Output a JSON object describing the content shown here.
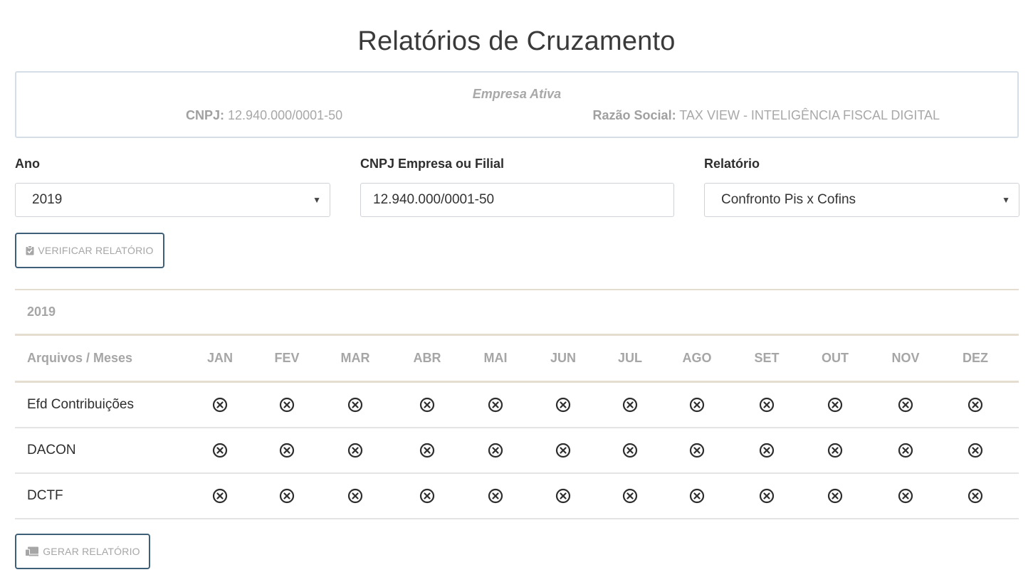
{
  "page_title": "Relatórios de Cruzamento",
  "company": {
    "heading": "Empresa Ativa",
    "cnpj_label": "CNPJ:",
    "cnpj_value": "12.940.000/0001-50",
    "razao_label": "Razão Social:",
    "razao_value": "TAX VIEW - INTELIGÊNCIA FISCAL DIGITAL"
  },
  "filters": {
    "ano_label": "Ano",
    "ano_value": "2019",
    "cnpj_label": "CNPJ Empresa ou Filial",
    "cnpj_value": "12.940.000/0001-50",
    "relatorio_label": "Relatório",
    "relatorio_value": "Confronto Pis x Cofins"
  },
  "buttons": {
    "verify": "VERIFICAR RELATÓRIO",
    "generate": "GERAR RELATÓRIO"
  },
  "section_year": "2019",
  "table": {
    "corner_header": "Arquivos / Meses",
    "months": [
      "JAN",
      "FEV",
      "MAR",
      "ABR",
      "MAI",
      "JUN",
      "JUL",
      "AGO",
      "SET",
      "OUT",
      "NOV",
      "DEZ"
    ],
    "rows": [
      {
        "label": "Efd Contribuições",
        "status": [
          "missing",
          "missing",
          "missing",
          "missing",
          "missing",
          "missing",
          "missing",
          "missing",
          "missing",
          "missing",
          "missing",
          "missing"
        ]
      },
      {
        "label": "DACON",
        "status": [
          "missing",
          "missing",
          "missing",
          "missing",
          "missing",
          "missing",
          "missing",
          "missing",
          "missing",
          "missing",
          "missing",
          "missing"
        ]
      },
      {
        "label": "DCTF",
        "status": [
          "missing",
          "missing",
          "missing",
          "missing",
          "missing",
          "missing",
          "missing",
          "missing",
          "missing",
          "missing",
          "missing",
          "missing"
        ]
      }
    ],
    "status_icon": "circle-x-icon"
  },
  "colors": {
    "accent_border": "#3e5f78",
    "muted_text": "#a6a6a6",
    "section_divider": "#e4ddd0"
  }
}
